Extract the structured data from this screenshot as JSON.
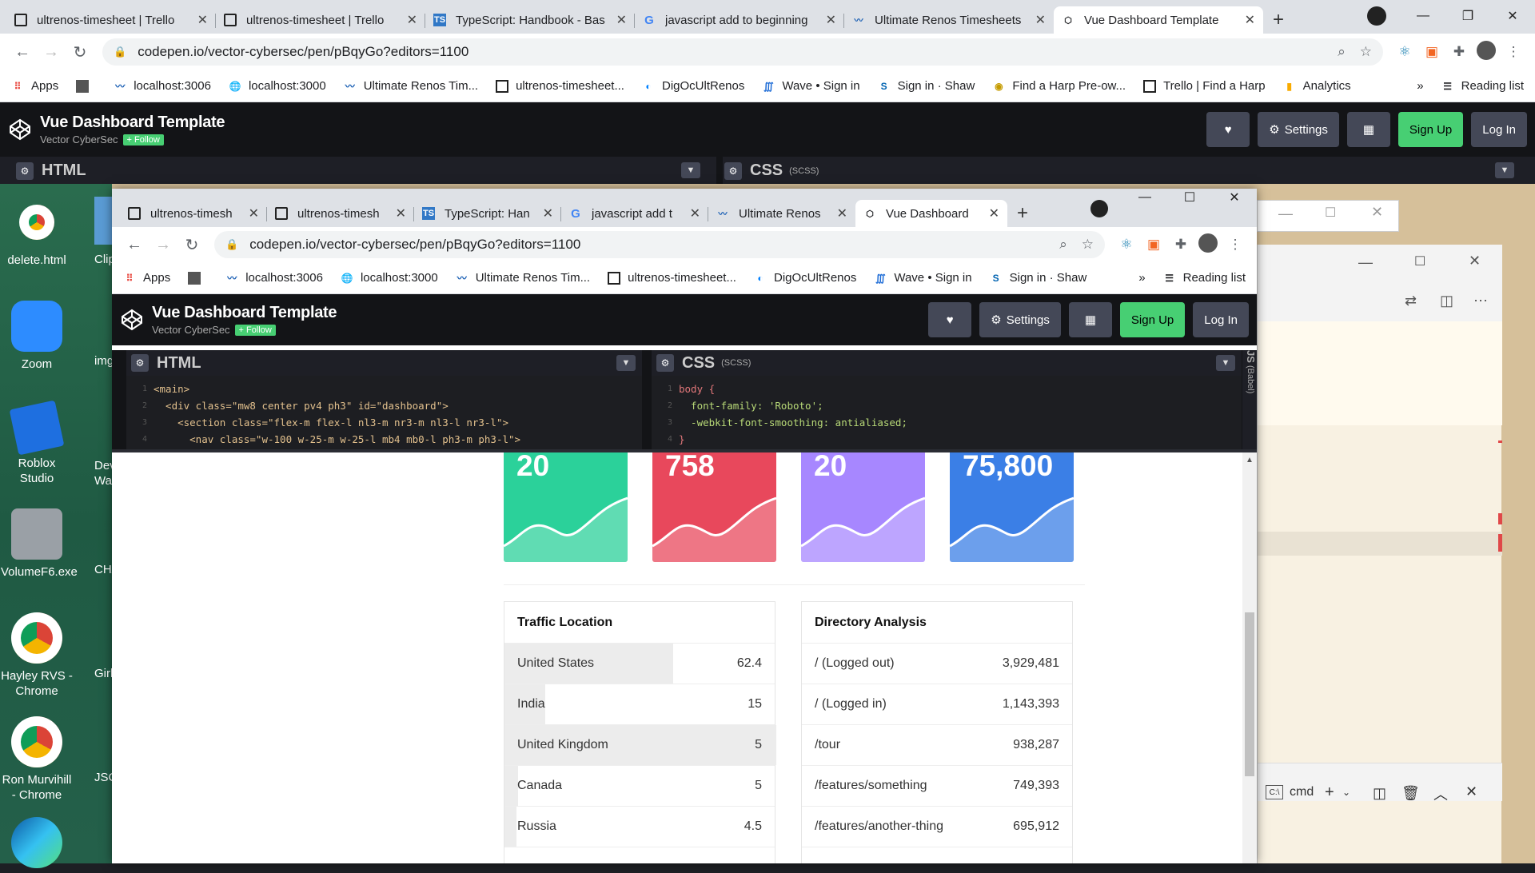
{
  "outer_browser": {
    "tabs": [
      {
        "title": "ultrenos-timesheet | Trello",
        "icon": "trello-icon"
      },
      {
        "title": "ultrenos-timesheet | Trello",
        "icon": "trello-icon"
      },
      {
        "title": "TypeScript: Handbook - Bas",
        "icon": "typescript-icon"
      },
      {
        "title": "javascript add to beginning",
        "icon": "google-icon"
      },
      {
        "title": "Ultimate Renos Timesheets",
        "icon": "renos-icon"
      },
      {
        "title": "Vue Dashboard Template",
        "icon": "codepen-icon"
      }
    ],
    "url": "codepen.io/vector-cybersec/pen/pBqyGo?editors=1100",
    "bookmarks": [
      "Apps",
      "",
      "localhost:3006",
      "localhost:3000",
      "Ultimate Renos Tim...",
      "ultrenos-timesheet...",
      "DigOcUltRenos",
      "Wave • Sign in",
      "Sign in · Shaw",
      "Find a Harp Pre-ow...",
      "Trello | Find a Harp",
      "Analytics"
    ],
    "reading_list": "Reading list",
    "more": "»"
  },
  "inner_browser": {
    "tabs": [
      {
        "title": "ultrenos-timesh",
        "icon": "trello-icon"
      },
      {
        "title": "ultrenos-timesh",
        "icon": "trello-icon"
      },
      {
        "title": "TypeScript: Han",
        "icon": "typescript-icon"
      },
      {
        "title": "javascript add t",
        "icon": "google-icon"
      },
      {
        "title": "Ultimate Renos",
        "icon": "renos-icon"
      },
      {
        "title": "Vue Dashboard",
        "icon": "codepen-icon"
      }
    ],
    "url": "codepen.io/vector-cybersec/pen/pBqyGo?editors=1100",
    "bookmarks": [
      "Apps",
      "",
      "localhost:3006",
      "localhost:3000",
      "Ultimate Renos Tim...",
      "ultrenos-timesheet...",
      "DigOcUltRenos",
      "Wave • Sign in",
      "Sign in · Shaw"
    ],
    "reading_list": "Reading list",
    "more": "»"
  },
  "codepen": {
    "title": "Vue Dashboard Template",
    "author": "Vector CyberSec",
    "follow": "+ Follow",
    "settings": "Settings",
    "signup": "Sign Up",
    "login": "Log In",
    "html_label": "HTML",
    "css_label": "CSS",
    "css_sub": "(SCSS)",
    "js_label": "JS",
    "js_sub": "(Babel)"
  },
  "html_code": [
    "<main>",
    "  <div class=\"mw8 center pv4 ph3\" id=\"dashboard\">",
    "    <section class=\"flex-m flex-l nl3-m nr3-m nl3-l nr3-l\">",
    "      <nav class=\"w-100 w-25-m w-25-l mb4 mb0-l ph3-m ph3-l\">"
  ],
  "css_code": [
    "body {",
    "  font-family: 'Roboto';",
    "  -webkit-font-smoothing: antialiased;",
    "}"
  ],
  "stat_cards": [
    {
      "value": "20",
      "color": "#2bd19a"
    },
    {
      "value": "758",
      "color": "#e8485c"
    },
    {
      "value": "20",
      "color": "#a787ff"
    },
    {
      "value": "75,800",
      "color": "#3b7fe6"
    }
  ],
  "traffic": {
    "title": "Traffic Location",
    "rows": [
      {
        "label": "United States",
        "value": "62.4"
      },
      {
        "label": "India",
        "value": "15"
      },
      {
        "label": "United Kingdom",
        "value": "5"
      },
      {
        "label": "Canada",
        "value": "5"
      },
      {
        "label": "Russia",
        "value": "4.5"
      }
    ]
  },
  "directory": {
    "title": "Directory Analysis",
    "rows": [
      {
        "label": "/ (Logged out)",
        "value": "3,929,481"
      },
      {
        "label": "/ (Logged in)",
        "value": "1,143,393"
      },
      {
        "label": "/tour",
        "value": "938,287"
      },
      {
        "label": "/features/something",
        "value": "749,393"
      },
      {
        "label": "/features/another-thing",
        "value": "695,912"
      }
    ]
  },
  "desktop_icons": [
    {
      "label": "delete.html",
      "icon": "chrome-icon"
    },
    {
      "label": "Zoom",
      "icon": "zoom-icon"
    },
    {
      "label": "Roblox Studio",
      "icon": "roblox-icon"
    },
    {
      "label": "VolumeF6.exe",
      "icon": "speaker-icon"
    },
    {
      "label": "Hayley RVS - Chrome",
      "icon": "chrome-icon"
    },
    {
      "label": "Ron Murvihill - Chrome",
      "icon": "chrome-icon"
    },
    {
      "label": "",
      "icon": "edge-icon"
    }
  ],
  "desktop_icons_col2": [
    "Clip",
    "imgfr",
    "Deve War",
    "CHAN",
    "GirlGu",
    "JSCod"
  ],
  "terminal": {
    "label": "cmd"
  }
}
